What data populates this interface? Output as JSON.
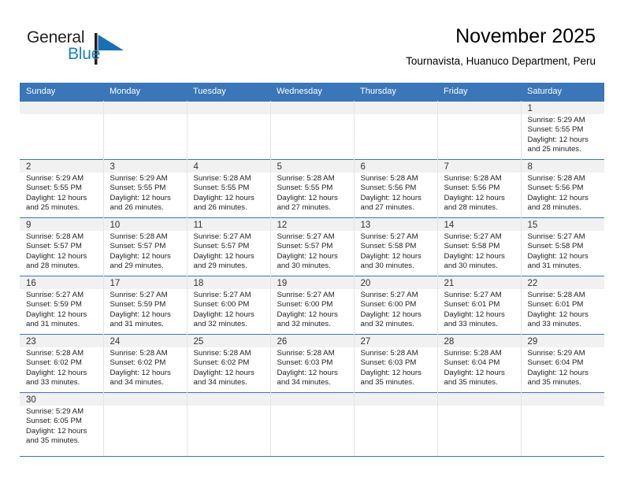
{
  "brand": {
    "name_part1": "General",
    "name_part2": "Blue",
    "flag_icon": "blue-flag-triangle",
    "accent_color": "#1b7fc4"
  },
  "header": {
    "title": "November 2025",
    "subtitle": "Tournavista, Huanuco Department, Peru"
  },
  "theme": {
    "header_bg": "#3a76b8",
    "daynum_band_bg": "#f1f1f1",
    "row_rule": "#3a76b8",
    "text": "#222222"
  },
  "weekdays": [
    "Sunday",
    "Monday",
    "Tuesday",
    "Wednesday",
    "Thursday",
    "Friday",
    "Saturday"
  ],
  "labels": {
    "sunrise": "Sunrise:",
    "sunset": "Sunset:",
    "daylight": "Daylight:"
  },
  "weeks": [
    [
      {
        "day": "",
        "empty": true
      },
      {
        "day": "",
        "empty": true
      },
      {
        "day": "",
        "empty": true
      },
      {
        "day": "",
        "empty": true
      },
      {
        "day": "",
        "empty": true
      },
      {
        "day": "",
        "empty": true
      },
      {
        "day": "1",
        "sunrise": "Sunrise: 5:29 AM",
        "sunset": "Sunset: 5:55 PM",
        "daylight1": "Daylight: 12 hours",
        "daylight2": "and 25 minutes."
      }
    ],
    [
      {
        "day": "2",
        "sunrise": "Sunrise: 5:29 AM",
        "sunset": "Sunset: 5:55 PM",
        "daylight1": "Daylight: 12 hours",
        "daylight2": "and 25 minutes."
      },
      {
        "day": "3",
        "sunrise": "Sunrise: 5:29 AM",
        "sunset": "Sunset: 5:55 PM",
        "daylight1": "Daylight: 12 hours",
        "daylight2": "and 26 minutes."
      },
      {
        "day": "4",
        "sunrise": "Sunrise: 5:28 AM",
        "sunset": "Sunset: 5:55 PM",
        "daylight1": "Daylight: 12 hours",
        "daylight2": "and 26 minutes."
      },
      {
        "day": "5",
        "sunrise": "Sunrise: 5:28 AM",
        "sunset": "Sunset: 5:55 PM",
        "daylight1": "Daylight: 12 hours",
        "daylight2": "and 27 minutes."
      },
      {
        "day": "6",
        "sunrise": "Sunrise: 5:28 AM",
        "sunset": "Sunset: 5:56 PM",
        "daylight1": "Daylight: 12 hours",
        "daylight2": "and 27 minutes."
      },
      {
        "day": "7",
        "sunrise": "Sunrise: 5:28 AM",
        "sunset": "Sunset: 5:56 PM",
        "daylight1": "Daylight: 12 hours",
        "daylight2": "and 28 minutes."
      },
      {
        "day": "8",
        "sunrise": "Sunrise: 5:28 AM",
        "sunset": "Sunset: 5:56 PM",
        "daylight1": "Daylight: 12 hours",
        "daylight2": "and 28 minutes."
      }
    ],
    [
      {
        "day": "9",
        "sunrise": "Sunrise: 5:28 AM",
        "sunset": "Sunset: 5:57 PM",
        "daylight1": "Daylight: 12 hours",
        "daylight2": "and 28 minutes."
      },
      {
        "day": "10",
        "sunrise": "Sunrise: 5:28 AM",
        "sunset": "Sunset: 5:57 PM",
        "daylight1": "Daylight: 12 hours",
        "daylight2": "and 29 minutes."
      },
      {
        "day": "11",
        "sunrise": "Sunrise: 5:27 AM",
        "sunset": "Sunset: 5:57 PM",
        "daylight1": "Daylight: 12 hours",
        "daylight2": "and 29 minutes."
      },
      {
        "day": "12",
        "sunrise": "Sunrise: 5:27 AM",
        "sunset": "Sunset: 5:57 PM",
        "daylight1": "Daylight: 12 hours",
        "daylight2": "and 30 minutes."
      },
      {
        "day": "13",
        "sunrise": "Sunrise: 5:27 AM",
        "sunset": "Sunset: 5:58 PM",
        "daylight1": "Daylight: 12 hours",
        "daylight2": "and 30 minutes."
      },
      {
        "day": "14",
        "sunrise": "Sunrise: 5:27 AM",
        "sunset": "Sunset: 5:58 PM",
        "daylight1": "Daylight: 12 hours",
        "daylight2": "and 30 minutes."
      },
      {
        "day": "15",
        "sunrise": "Sunrise: 5:27 AM",
        "sunset": "Sunset: 5:58 PM",
        "daylight1": "Daylight: 12 hours",
        "daylight2": "and 31 minutes."
      }
    ],
    [
      {
        "day": "16",
        "sunrise": "Sunrise: 5:27 AM",
        "sunset": "Sunset: 5:59 PM",
        "daylight1": "Daylight: 12 hours",
        "daylight2": "and 31 minutes."
      },
      {
        "day": "17",
        "sunrise": "Sunrise: 5:27 AM",
        "sunset": "Sunset: 5:59 PM",
        "daylight1": "Daylight: 12 hours",
        "daylight2": "and 31 minutes."
      },
      {
        "day": "18",
        "sunrise": "Sunrise: 5:27 AM",
        "sunset": "Sunset: 6:00 PM",
        "daylight1": "Daylight: 12 hours",
        "daylight2": "and 32 minutes."
      },
      {
        "day": "19",
        "sunrise": "Sunrise: 5:27 AM",
        "sunset": "Sunset: 6:00 PM",
        "daylight1": "Daylight: 12 hours",
        "daylight2": "and 32 minutes."
      },
      {
        "day": "20",
        "sunrise": "Sunrise: 5:27 AM",
        "sunset": "Sunset: 6:00 PM",
        "daylight1": "Daylight: 12 hours",
        "daylight2": "and 32 minutes."
      },
      {
        "day": "21",
        "sunrise": "Sunrise: 5:27 AM",
        "sunset": "Sunset: 6:01 PM",
        "daylight1": "Daylight: 12 hours",
        "daylight2": "and 33 minutes."
      },
      {
        "day": "22",
        "sunrise": "Sunrise: 5:28 AM",
        "sunset": "Sunset: 6:01 PM",
        "daylight1": "Daylight: 12 hours",
        "daylight2": "and 33 minutes."
      }
    ],
    [
      {
        "day": "23",
        "sunrise": "Sunrise: 5:28 AM",
        "sunset": "Sunset: 6:02 PM",
        "daylight1": "Daylight: 12 hours",
        "daylight2": "and 33 minutes."
      },
      {
        "day": "24",
        "sunrise": "Sunrise: 5:28 AM",
        "sunset": "Sunset: 6:02 PM",
        "daylight1": "Daylight: 12 hours",
        "daylight2": "and 34 minutes."
      },
      {
        "day": "25",
        "sunrise": "Sunrise: 5:28 AM",
        "sunset": "Sunset: 6:02 PM",
        "daylight1": "Daylight: 12 hours",
        "daylight2": "and 34 minutes."
      },
      {
        "day": "26",
        "sunrise": "Sunrise: 5:28 AM",
        "sunset": "Sunset: 6:03 PM",
        "daylight1": "Daylight: 12 hours",
        "daylight2": "and 34 minutes."
      },
      {
        "day": "27",
        "sunrise": "Sunrise: 5:28 AM",
        "sunset": "Sunset: 6:03 PM",
        "daylight1": "Daylight: 12 hours",
        "daylight2": "and 35 minutes."
      },
      {
        "day": "28",
        "sunrise": "Sunrise: 5:28 AM",
        "sunset": "Sunset: 6:04 PM",
        "daylight1": "Daylight: 12 hours",
        "daylight2": "and 35 minutes."
      },
      {
        "day": "29",
        "sunrise": "Sunrise: 5:29 AM",
        "sunset": "Sunset: 6:04 PM",
        "daylight1": "Daylight: 12 hours",
        "daylight2": "and 35 minutes."
      }
    ],
    [
      {
        "day": "30",
        "sunrise": "Sunrise: 5:29 AM",
        "sunset": "Sunset: 6:05 PM",
        "daylight1": "Daylight: 12 hours",
        "daylight2": "and 35 minutes."
      },
      {
        "day": "",
        "empty": true
      },
      {
        "day": "",
        "empty": true
      },
      {
        "day": "",
        "empty": true
      },
      {
        "day": "",
        "empty": true
      },
      {
        "day": "",
        "empty": true
      },
      {
        "day": "",
        "empty": true
      }
    ]
  ]
}
